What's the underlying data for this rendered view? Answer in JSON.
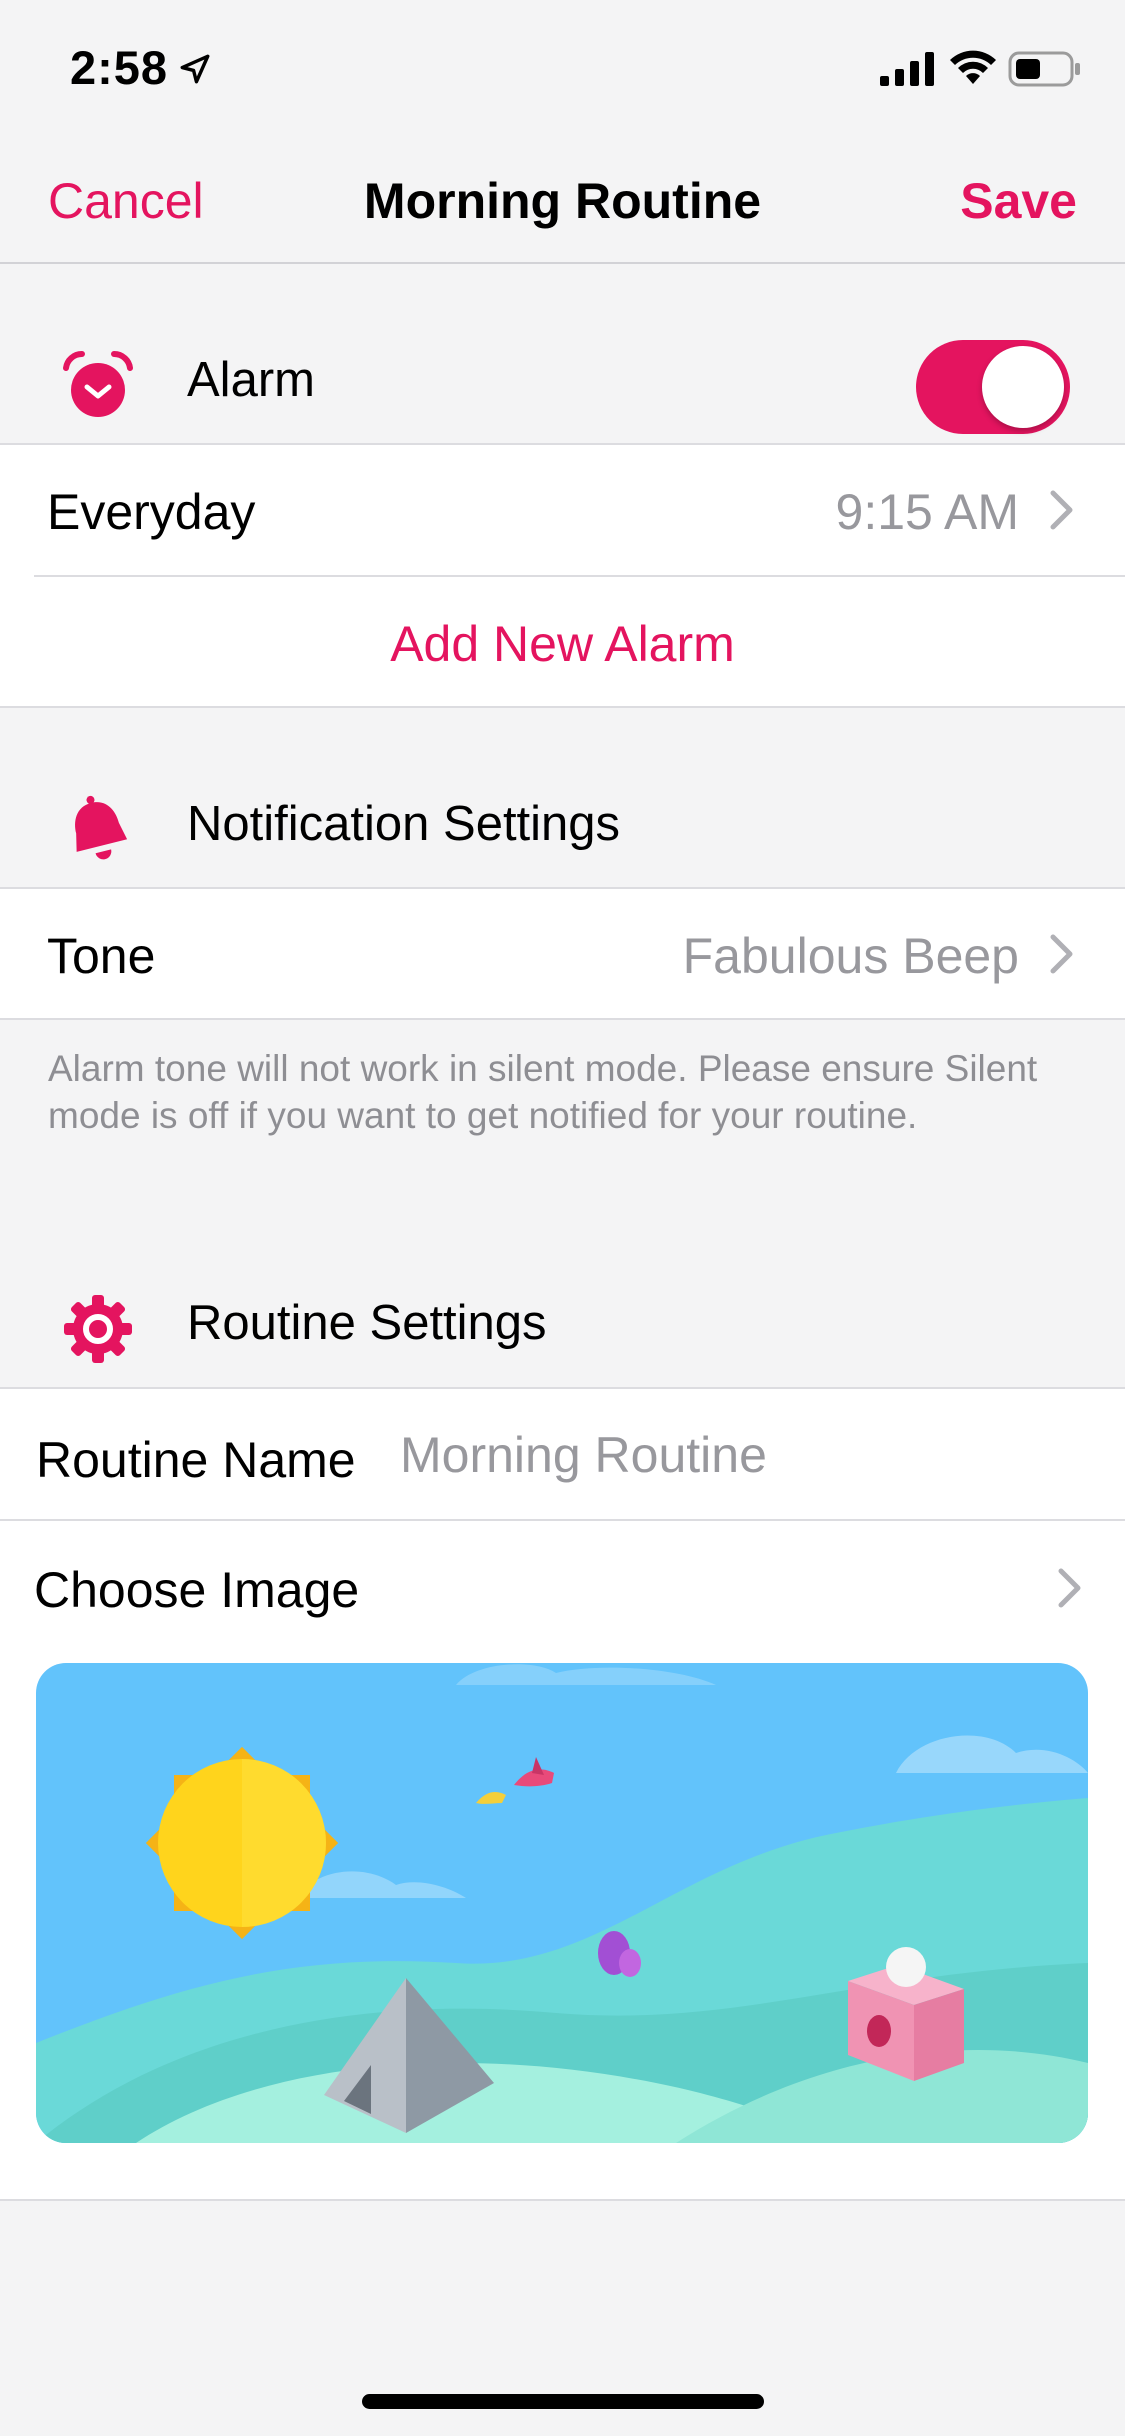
{
  "status_bar": {
    "time": "2:58",
    "icons": [
      "location-arrow-icon",
      "cellular-signal-icon",
      "wifi-icon",
      "battery-icon"
    ]
  },
  "nav": {
    "cancel_label": "Cancel",
    "title": "Morning Routine",
    "save_label": "Save"
  },
  "alarm_section": {
    "icon": "alarm-clock-icon",
    "label": "Alarm",
    "enabled": true,
    "alarms": [
      {
        "label": "Everyday",
        "time": "9:15 AM"
      }
    ],
    "add_label": "Add New Alarm"
  },
  "notification_section": {
    "icon": "bell-icon",
    "label": "Notification Settings",
    "tone_label": "Tone",
    "tone_value": "Fabulous Beep",
    "footnote": "Alarm tone will not work in silent mode. Please ensure Silent mode is off if you want to get notified for your routine."
  },
  "routine_section": {
    "icon": "gear-icon",
    "label": "Routine Settings",
    "name_label": "Routine Name",
    "name_placeholder": "Morning Routine",
    "name_value": "",
    "choose_image_label": "Choose Image"
  },
  "colors": {
    "accent": "#e4145f",
    "secondary_text": "#98989d",
    "background": "#f4f4f5",
    "sky": "#62c3fb"
  }
}
